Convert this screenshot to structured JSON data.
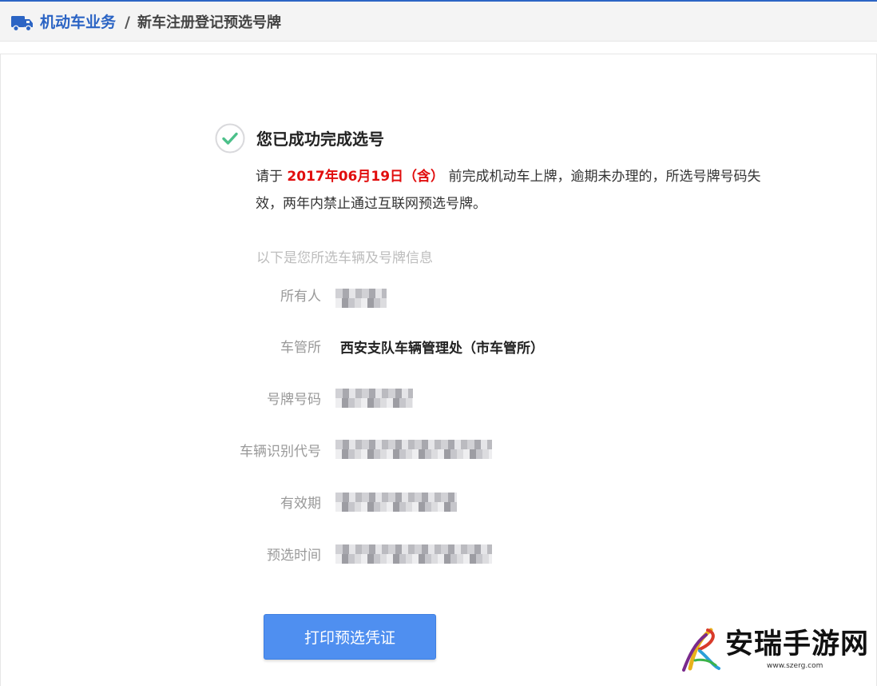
{
  "header": {
    "crumb_main": "机动车业务",
    "crumb_separator": "/",
    "crumb_sub": "新车注册登记预选号牌"
  },
  "result": {
    "title": "您已成功完成选号",
    "notice_prefix": "请于",
    "deadline": "2017年06月19日（含）",
    "notice_suffix": "前完成机动车上牌，逾期未办理的，所选号牌号码失效，两年内禁止通过互联网预选号牌。"
  },
  "info": {
    "caption": "以下是您所选车辆及号牌信息",
    "rows": [
      {
        "label": "所有人",
        "value": ""
      },
      {
        "label": "车管所",
        "value": "西安支队车辆管理处（市车管所）"
      },
      {
        "label": "号牌号码",
        "value": ""
      },
      {
        "label": "车辆识别代号",
        "value": ""
      },
      {
        "label": "有效期",
        "value": ""
      },
      {
        "label": "预选时间",
        "value": ""
      }
    ]
  },
  "actions": {
    "print_label": "打印预选凭证"
  },
  "watermark": {
    "brand": "安瑞手游网",
    "url": "www.szerg.com"
  },
  "colors": {
    "accent": "#2b64c4",
    "button": "#4f8ff0",
    "deadline": "#e10d0d",
    "check": "#4cc08a"
  },
  "icons": {
    "header": "truck-icon",
    "status": "check-circle-icon"
  }
}
